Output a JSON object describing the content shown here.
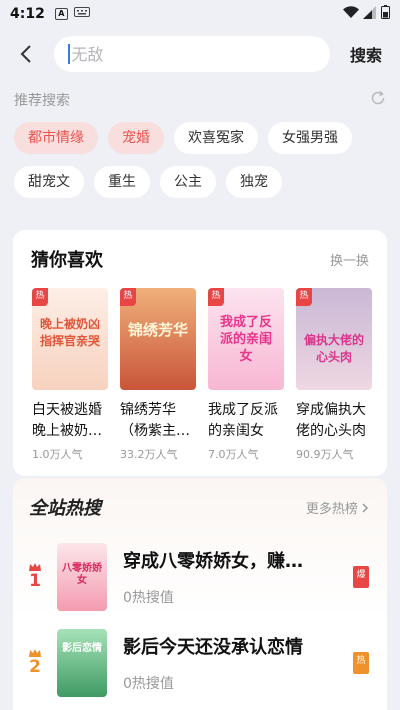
{
  "status": {
    "time": "4:12"
  },
  "search": {
    "placeholder": "无敌",
    "button": "搜索"
  },
  "recommend": {
    "title": "推荐搜索",
    "tags": [
      "都市情缘",
      "宠婚",
      "欢喜冤家",
      "女强男强",
      "甜宠文",
      "重生",
      "公主",
      "独宠"
    ]
  },
  "guess": {
    "title": "猜你喜欢",
    "swap": "换一换",
    "books": [
      {
        "badge": "热",
        "title": "白天被逃婚晚上被奶…",
        "popularity": "1.0万人气",
        "cover_text": "晚上被奶凶指挥官亲哭"
      },
      {
        "badge": "热",
        "title": "锦绣芳华（杨紫主…",
        "popularity": "33.2万人气",
        "cover_text": "锦绣芳华"
      },
      {
        "badge": "热",
        "title": "我成了反派的亲闺女",
        "popularity": "7.0万人气",
        "cover_text": "我成了反派的亲闺女"
      },
      {
        "badge": "热",
        "title": "穿成偏执大佬的心头肉",
        "popularity": "90.9万人气",
        "cover_text": "偏执大佬的心头肉"
      }
    ]
  },
  "hot": {
    "title": "全站热搜",
    "more": "更多热榜",
    "items": [
      {
        "rank": "1",
        "title": "穿成八零娇娇女，赚…",
        "value": "0热搜值",
        "flag": "爆",
        "cover_text": "八零娇娇女"
      },
      {
        "rank": "2",
        "title": "影后今天还没承认恋情",
        "value": "0热搜值",
        "flag": "热",
        "cover_text": "影后恋情"
      }
    ]
  },
  "colors": {
    "accent": "#e8544e",
    "rank1": "#e84545",
    "rank2": "#f0922a",
    "tag_hot_bg": "#f9dede"
  }
}
